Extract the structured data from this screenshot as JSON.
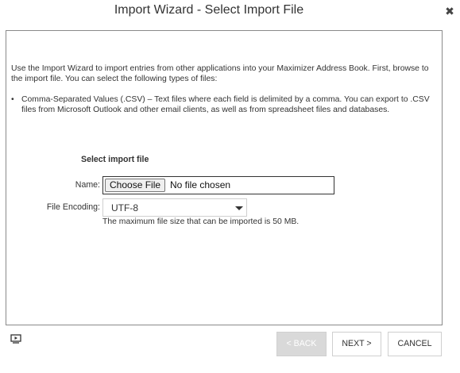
{
  "dialog": {
    "title": "Import Wizard - Select Import File",
    "close_symbol": "✖"
  },
  "content": {
    "intro": "Use the Import Wizard to import entries from other applications into your Maximizer Address Book. First, browse to the import file. You can select the following types of files:",
    "bullets": [
      {
        "symbol": "•",
        "text": "Comma-Separated Values (.CSV) – Text files where each field is delimited by a comma. You can export to .CSV files from Microsoft Outlook and other email clients, as well as from spreadsheet files and databases."
      }
    ],
    "section_heading": "Select import file",
    "name_label": "Name:",
    "choose_file_label": "Choose File",
    "no_file_text": "No file chosen",
    "encoding_label": "File Encoding:",
    "encoding_value": "UTF-8",
    "limit_note": "The maximum file size that can be imported is 50 MB."
  },
  "footer": {
    "help_icon": "help-video-icon",
    "back_label": "< BACK",
    "next_label": "NEXT >",
    "cancel_label": "CANCEL"
  },
  "colors": {
    "back_disabled_bg": "#d9d9d9",
    "border": "#8a8a8a",
    "text": "#333333"
  }
}
